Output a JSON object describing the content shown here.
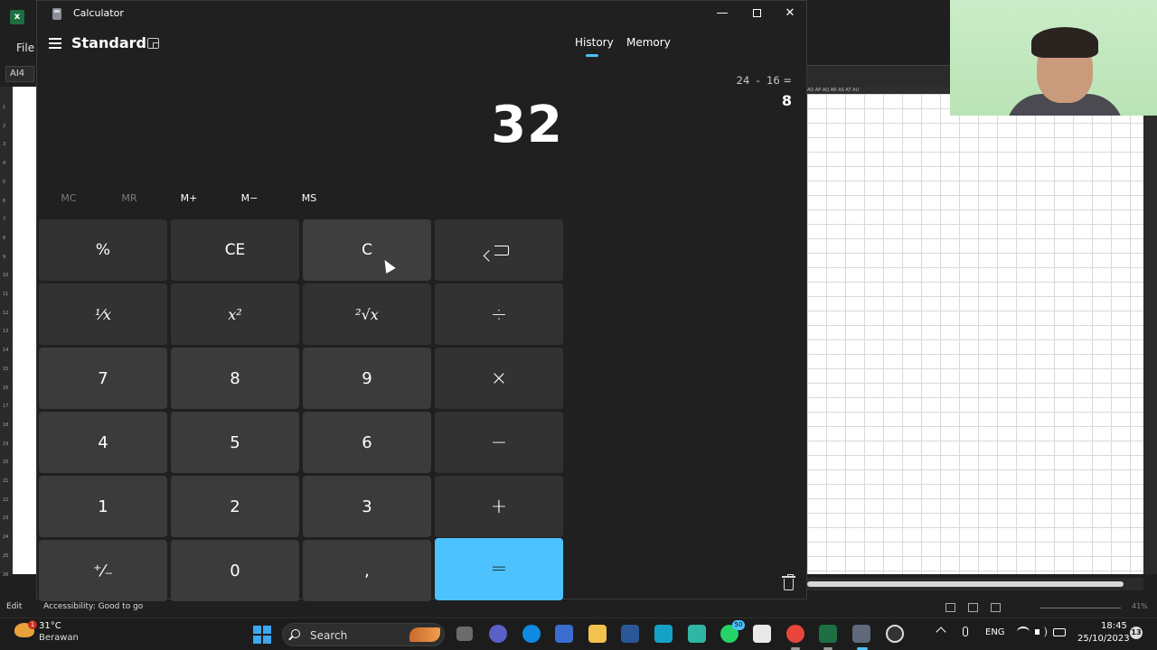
{
  "excel": {
    "file_menu": "File",
    "name_box": "AI4",
    "column_headers": "AO AP AQ AR AS AT AU",
    "row_numbers": [
      "1",
      "2",
      "3",
      "4",
      "5",
      "6",
      "7",
      "8",
      "9",
      "10",
      "11",
      "12",
      "13",
      "14",
      "15",
      "16",
      "17",
      "18",
      "19",
      "20",
      "21",
      "22",
      "23",
      "24",
      "25",
      "26"
    ],
    "status_mode": "Edit",
    "status_accessibility": "Accessibility: Good to go",
    "zoom": "41%"
  },
  "calculator": {
    "window_title": "Calculator",
    "mode_title": "Standard",
    "tabs": {
      "history": "History",
      "memory": "Memory"
    },
    "history": {
      "expression": "24  -  16 =",
      "result": "8"
    },
    "display_value": "32",
    "memory_buttons": [
      {
        "label": "MC",
        "enabled": false
      },
      {
        "label": "MR",
        "enabled": false
      },
      {
        "label": "M+",
        "enabled": true
      },
      {
        "label": "M−",
        "enabled": true
      },
      {
        "label": "MS",
        "enabled": true
      }
    ],
    "keys": {
      "percent": "%",
      "ce": "CE",
      "clear": "C",
      "reciprocal": "¹⁄x",
      "square": "x²",
      "sqrt": "²√x",
      "divide": "÷",
      "multiply": "×",
      "minus": "−",
      "plus": "+",
      "seven": "7",
      "eight": "8",
      "nine": "9",
      "four": "4",
      "five": "5",
      "six": "6",
      "one": "1",
      "two": "2",
      "three": "3",
      "negate": "⁺⁄₋",
      "zero": "0",
      "decimal": ",",
      "equals": "="
    },
    "accent_color": "#4cc2ff"
  },
  "taskbar": {
    "weather_temp": "31°C",
    "weather_condition": "Berawan",
    "weather_badge": "1",
    "search_placeholder": "Search",
    "whatsapp_badge": "50",
    "language": "ENG",
    "time": "18:45",
    "date": "25/10/2023",
    "notification_count": "13"
  }
}
